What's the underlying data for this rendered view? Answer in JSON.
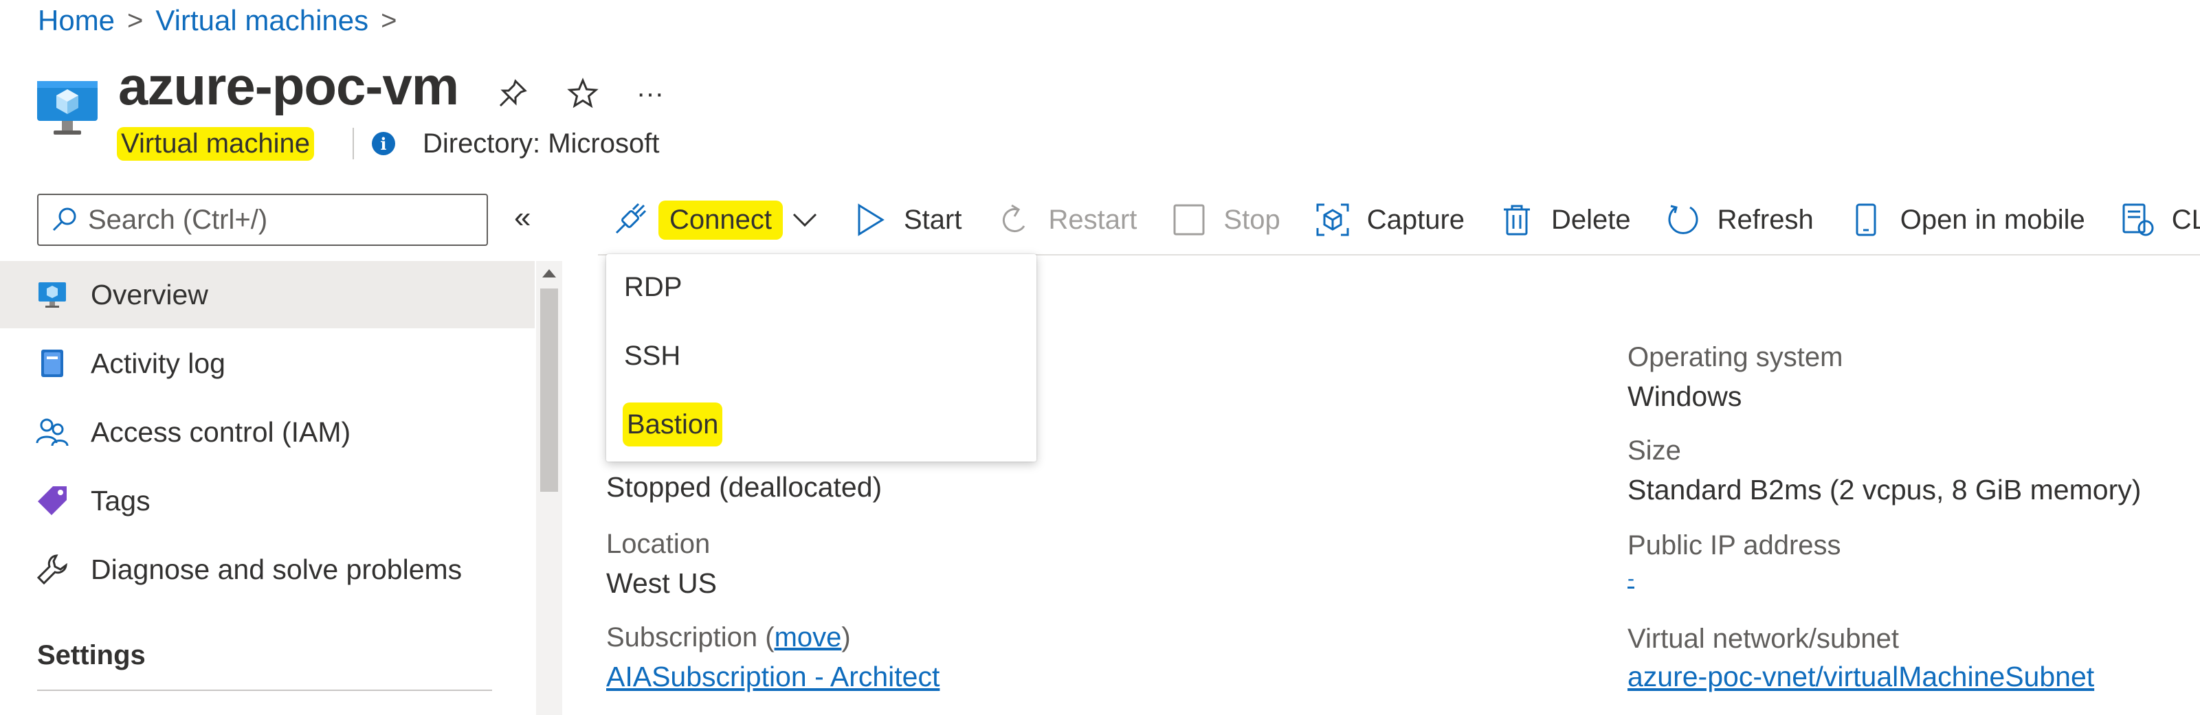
{
  "breadcrumb": {
    "items": [
      "Home",
      "Virtual machines"
    ]
  },
  "header": {
    "title": "azure-poc-vm",
    "resource_type": "Virtual machine",
    "directory": "Directory: Microsoft",
    "more_label": "···"
  },
  "search": {
    "placeholder": "Search (Ctrl+/)",
    "collapse_label": "«"
  },
  "toolbar": {
    "connect": "Connect",
    "start": "Start",
    "restart": "Restart",
    "stop": "Stop",
    "capture": "Capture",
    "delete": "Delete",
    "refresh": "Refresh",
    "open_in_mobile": "Open in mobile",
    "cli": "CLI"
  },
  "connect_menu": {
    "items": [
      "RDP",
      "SSH",
      "Bastion"
    ]
  },
  "sidebar": {
    "items": [
      {
        "label": "Overview",
        "icon": "vm-icon"
      },
      {
        "label": "Activity log",
        "icon": "activity-log-icon"
      },
      {
        "label": "Access control (IAM)",
        "icon": "people-icon"
      },
      {
        "label": "Tags",
        "icon": "tag-icon"
      },
      {
        "label": "Diagnose and solve problems",
        "icon": "wrench-icon"
      }
    ],
    "section": "Settings"
  },
  "essentials": {
    "status_value": "Stopped (deallocated)",
    "location_label": "Location",
    "location_value": "West US",
    "subscription_label_prefix": "Subscription (",
    "subscription_move": "move",
    "subscription_label_suffix": ")",
    "subscription_value": "AIASubscription - Architect",
    "os_label": "Operating system",
    "os_value": "Windows",
    "size_label": "Size",
    "size_value": "Standard B2ms (2 vcpus, 8 GiB memory)",
    "public_ip_label": "Public IP address",
    "public_ip_value": "-",
    "vnet_label": "Virtual network/subnet",
    "vnet_value": "azure-poc-vnet/virtualMachineSubnet"
  },
  "colors": {
    "accent": "#0f6cbd",
    "highlight": "#fdf000",
    "selected_bg": "#edebe9"
  }
}
